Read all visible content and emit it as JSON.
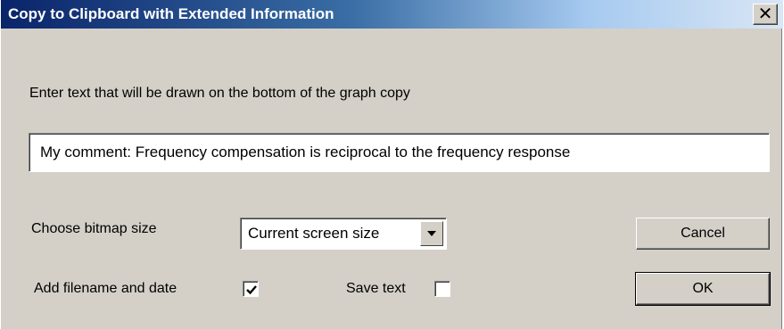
{
  "window": {
    "title": "Copy to Clipboard with Extended Information",
    "close_glyph": "✕"
  },
  "prompt": "Enter text that will be drawn on the bottom of the graph copy",
  "comment": {
    "value": "My comment: Frequency compensation is reciprocal to the frequency response"
  },
  "bitmap_size": {
    "label": "Choose bitmap size",
    "selected": "Current screen size"
  },
  "add_filename": {
    "label": "Add filename and date",
    "checked": true
  },
  "save_text": {
    "label": "Save text",
    "checked": false
  },
  "buttons": {
    "cancel": "Cancel",
    "ok": "OK"
  },
  "icons": {
    "close": "close-icon",
    "dropdown": "chevron-down-icon",
    "check": "checkmark-icon"
  },
  "colors": {
    "title_start": "#0a246a",
    "title_end": "#d9e6f5",
    "dialog_bg": "#d4d0c8"
  }
}
